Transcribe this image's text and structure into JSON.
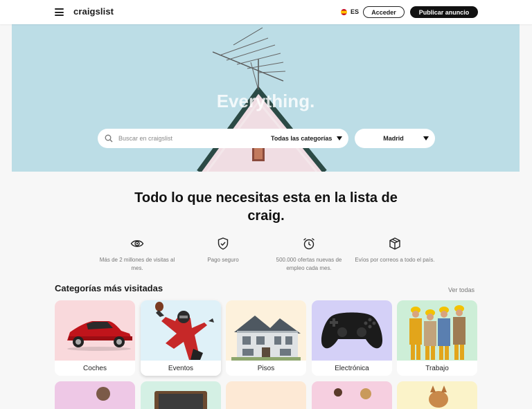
{
  "header": {
    "logo": "craigslist",
    "language": "ES",
    "login_label": "Acceder",
    "post_label": "Publicar anuncio",
    "menu_icon": "hamburger-icon"
  },
  "hero": {
    "title": "Everything.",
    "search_placeholder": "Buscar en craigslist",
    "category_value": "Todas las categorías",
    "city_value": "Madrid"
  },
  "tagline": "Todo lo que necesitas esta en la lista de craig.",
  "features": [
    {
      "icon": "eye-icon",
      "label": "Más de 2 millones de visitas al mes."
    },
    {
      "icon": "shield-check-icon",
      "label": "Pago seguro"
    },
    {
      "icon": "alarm-clock-icon",
      "label": "500.000 ofertas nuevas de empleo cada mes."
    },
    {
      "icon": "package-icon",
      "label": "Evíos por correos a todo el país."
    }
  ],
  "categories_section": {
    "title": "Categorías más visitadas",
    "see_all": "Ver todas",
    "items": [
      {
        "label": "Coches",
        "bg": "#f9d9dc"
      },
      {
        "label": "Eventos",
        "bg": "#dff1f8"
      },
      {
        "label": "Pisos",
        "bg": "#fdf1dc"
      },
      {
        "label": "Electrónica",
        "bg": "#d4d0f7"
      },
      {
        "label": "Trabajo",
        "bg": "#cdeed7"
      }
    ],
    "row2_bgs": [
      "#eec8e6",
      "#d4f0e4",
      "#fde9d5",
      "#f6cfe0",
      "#fbf3c9"
    ]
  },
  "colors": {
    "hero_bg": "#bcdde6",
    "accent": "#111111"
  }
}
